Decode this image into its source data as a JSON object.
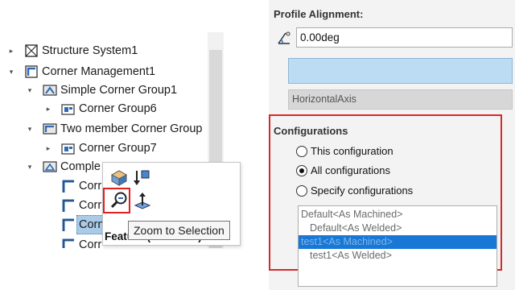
{
  "tree": {
    "items": [
      {
        "label": "Structure System1",
        "arrow": "▸",
        "icon": "structure-system-icon"
      },
      {
        "label": "Corner Management1",
        "arrow": "▾",
        "icon": "corner-management-icon"
      },
      {
        "label": "Simple Corner Group1",
        "arrow": "▾",
        "icon": "simple-corner-group-icon"
      },
      {
        "label": "Corner Group6",
        "arrow": "▸",
        "icon": "corner-group-icon"
      },
      {
        "label": "Two member Corner Group",
        "arrow": "▾",
        "icon": "two-member-corner-group-icon"
      },
      {
        "label": "Corner Group7",
        "arrow": "▸",
        "icon": "corner-group-icon"
      },
      {
        "label": "Comple",
        "arrow": "▾",
        "icon": "complex-corner-group-icon"
      },
      {
        "label": "Corr",
        "arrow": "",
        "icon": "corner-treatment-icon"
      },
      {
        "label": "Corr",
        "arrow": "",
        "icon": "corner-treatment-icon"
      },
      {
        "label": "Corner27",
        "arrow": "",
        "icon": "corner-treatment-icon"
      },
      {
        "label": "Corr",
        "arrow": "",
        "icon": "corner-treatment-icon"
      }
    ]
  },
  "context_toolbar": {
    "label": "Feature (Corner27)",
    "tooltip": "Zoom to Selection",
    "buttons": [
      "edit-feature-icon",
      "rollback-icon",
      "zoom-to-selection-icon",
      "normal-to-icon"
    ]
  },
  "panel": {
    "profile_alignment_title": "Profile Alignment:",
    "angle_value": "0.00deg",
    "axis_field": "HorizontalAxis",
    "configurations_title": "Configurations",
    "radios": [
      {
        "label": "This configuration",
        "checked": false
      },
      {
        "label": "All configurations",
        "checked": true
      },
      {
        "label": "Specify configurations",
        "checked": false
      }
    ],
    "config_list": [
      {
        "label": "Default<As Machined>",
        "selected": false
      },
      {
        "label": "Default<As Welded>",
        "selected": false
      },
      {
        "label": "test1<As Machined>",
        "selected": true
      },
      {
        "label": "test1<As Welded>",
        "selected": false
      }
    ]
  },
  "colors": {
    "highlight_red": "#e02020",
    "selection_blue": "#1978d6",
    "tree_selected": "#a9cbe8"
  }
}
